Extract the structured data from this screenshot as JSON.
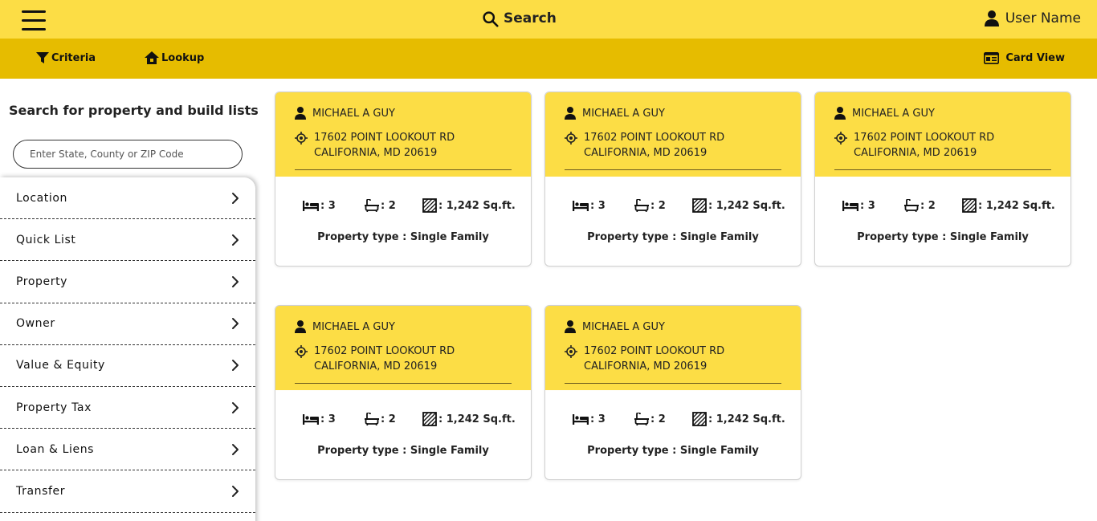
{
  "topbar": {
    "search_label": "Search",
    "user_label": "User Name"
  },
  "subbar": {
    "criteria_label": "Criteria",
    "lookup_label": "Lookup",
    "cardview_label": "Card View"
  },
  "sidebar": {
    "title": "Search for property and build lists",
    "search_placeholder": "Enter State, County or ZIP Code",
    "items": [
      {
        "label": "Location"
      },
      {
        "label": "Quick List"
      },
      {
        "label": "Property"
      },
      {
        "label": "Owner"
      },
      {
        "label": "Value & Equity"
      },
      {
        "label": "Property Tax"
      },
      {
        "label": "Loan & Liens"
      },
      {
        "label": "Transfer"
      }
    ]
  },
  "cards": [
    {
      "owner": "MICHAEL A GUY",
      "address_line1": "17602 POINT LOOKOUT RD",
      "address_line2": "CALIFORNIA, MD 20619",
      "beds": ": 3",
      "baths": ": 2",
      "area": ": 1,242 Sq.ft.",
      "type": "Property type : Single Family"
    },
    {
      "owner": "MICHAEL A GUY",
      "address_line1": "17602 POINT LOOKOUT RD",
      "address_line2": "CALIFORNIA, MD 20619",
      "beds": ": 3",
      "baths": ": 2",
      "area": ": 1,242 Sq.ft.",
      "type": "Property type : Single Family"
    },
    {
      "owner": "MICHAEL A GUY",
      "address_line1": "17602 POINT LOOKOUT RD",
      "address_line2": "CALIFORNIA, MD 20619",
      "beds": ": 3",
      "baths": ": 2",
      "area": ": 1,242 Sq.ft.",
      "type": "Property type : Single Family"
    },
    {
      "owner": "MICHAEL A GUY",
      "address_line1": "17602 POINT LOOKOUT RD",
      "address_line2": "CALIFORNIA, MD 20619",
      "beds": ": 3",
      "baths": ": 2",
      "area": ": 1,242 Sq.ft.",
      "type": "Property type : Single Family"
    },
    {
      "owner": "MICHAEL A GUY",
      "address_line1": "17602 POINT LOOKOUT RD",
      "address_line2": "CALIFORNIA, MD 20619",
      "beds": ": 3",
      "baths": ": 2",
      "area": ": 1,242 Sq.ft.",
      "type": "Property type : Single Family"
    }
  ],
  "colors": {
    "topbar_bg": "#fcdd45",
    "subbar_bg": "#e6bc00",
    "card_header_bg": "#fcdd45"
  },
  "icons": {
    "menu": "hamburger-icon",
    "search": "search-icon",
    "user": "user-icon",
    "criteria": "filter-icon",
    "lookup": "home-icon",
    "cardview": "id-card-icon",
    "chevron": "chevron-right-icon",
    "owner": "person-icon",
    "address": "location-target-icon",
    "beds": "bed-icon",
    "baths": "bathtub-icon",
    "area": "area-icon"
  }
}
